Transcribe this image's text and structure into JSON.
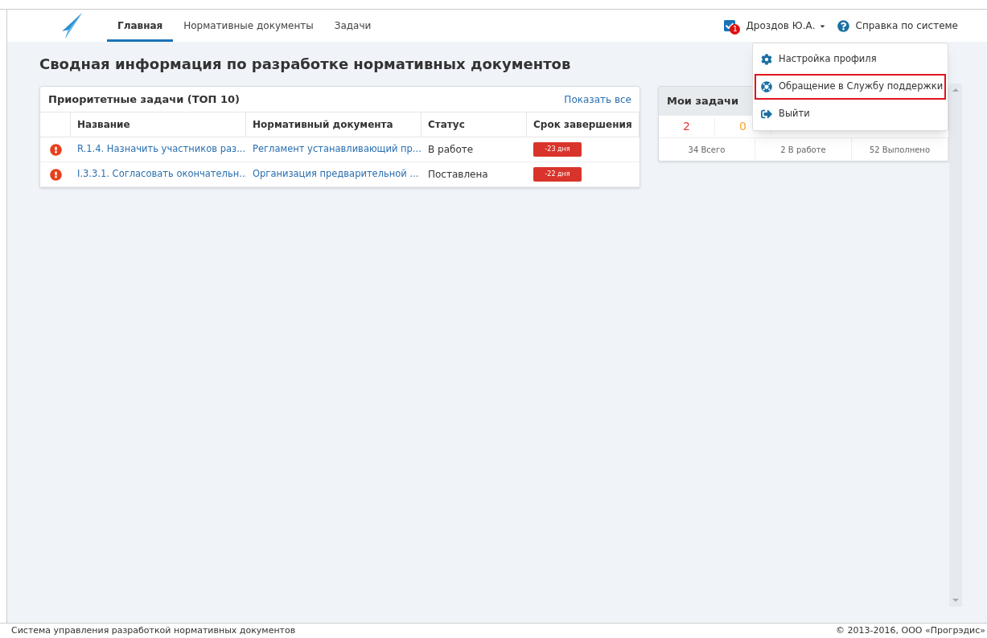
{
  "nav": {
    "tabs": [
      {
        "label": "Главная",
        "selected": true
      },
      {
        "label": "Нормативные документы",
        "selected": false
      },
      {
        "label": "Задачи",
        "selected": false
      }
    ],
    "notifications": "1",
    "user": "Дроздов Ю.А.",
    "help": "Справка по системе"
  },
  "user_menu": {
    "expanded": true,
    "items": [
      {
        "label": "Настройка профиля",
        "kind": "settings",
        "selected": false
      },
      {
        "label": "Обращение в Службу поддержки",
        "kind": "support",
        "selected": true
      },
      {
        "label": "Выйти",
        "kind": "logout",
        "selected": false
      }
    ]
  },
  "page_title": "Сводная информация по разработке нормативных документов",
  "priority_tasks": {
    "title": "Приоритетные задачи (ТОП 10)",
    "show_all": "Показать все",
    "columns": [
      "Название",
      "Нормативный документа",
      "Статус",
      "Срок завершения"
    ],
    "rows": [
      {
        "name": "R.1.4. Назначить участников раз...",
        "document": "Регламент устанавливающий пр...",
        "status": "В работе",
        "due": "-23 дня"
      },
      {
        "name": "I.3.3.1. Согласовать окончательн...",
        "document": "Организация предварительной ...",
        "status": "Поставлена",
        "due": "-22 дня"
      }
    ]
  },
  "my_tasks": {
    "title": "Мои задачи",
    "counts": [
      {
        "value": "2",
        "color": "#e53935"
      },
      {
        "value": "0",
        "color": "#f5a623"
      }
    ],
    "totals": [
      "34 Всего",
      "2 В работе",
      "52 Выполнено"
    ]
  },
  "status_bar": {
    "left": "Система управления разработкой нормативных документов",
    "right": "© 2013-2016, ООО «Прогрэдис»"
  }
}
